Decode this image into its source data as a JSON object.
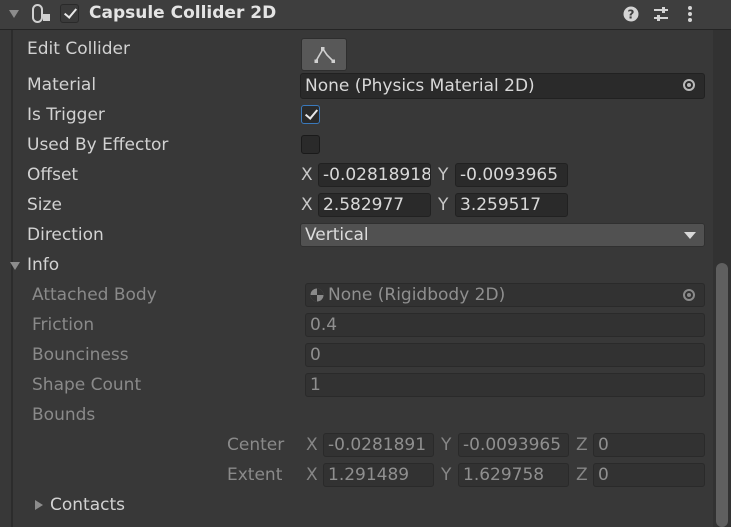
{
  "header": {
    "title": "Capsule Collider 2D",
    "enabled": true,
    "icons": [
      "foldout-expanded-icon",
      "capsule-collider-icon",
      "help-icon",
      "presets-icon",
      "kebab-menu-icon"
    ]
  },
  "properties": {
    "edit_collider": {
      "label": "Edit Collider",
      "button_icon": "edit-collider-icon"
    },
    "material": {
      "label": "Material",
      "value": "None (Physics Material 2D)"
    },
    "is_trigger": {
      "label": "Is Trigger",
      "checked": true
    },
    "used_by_effector": {
      "label": "Used By Effector",
      "checked": false
    },
    "offset": {
      "label": "Offset",
      "x_label": "X",
      "x": "-0.02818918",
      "y_label": "Y",
      "y": "-0.0093965"
    },
    "size": {
      "label": "Size",
      "x_label": "X",
      "x": "2.582977",
      "y_label": "Y",
      "y": "3.259517"
    },
    "direction": {
      "label": "Direction",
      "value": "Vertical"
    }
  },
  "info": {
    "label": "Info",
    "attached_body": {
      "label": "Attached Body",
      "value": "None (Rigidbody 2D)"
    },
    "friction": {
      "label": "Friction",
      "value": "0.4"
    },
    "bounciness": {
      "label": "Bounciness",
      "value": "0"
    },
    "shape_count": {
      "label": "Shape Count",
      "value": "1"
    },
    "bounds": {
      "label": "Bounds",
      "center": {
        "label": "Center",
        "x_label": "X",
        "x": "-0.0281891",
        "y_label": "Y",
        "y": "-0.0093965",
        "z_label": "Z",
        "z": "0"
      },
      "extent": {
        "label": "Extent",
        "x_label": "X",
        "x": "1.291489",
        "y_label": "Y",
        "y": "1.629758",
        "z_label": "Z",
        "z": "0"
      }
    },
    "contacts": {
      "label": "Contacts"
    }
  }
}
